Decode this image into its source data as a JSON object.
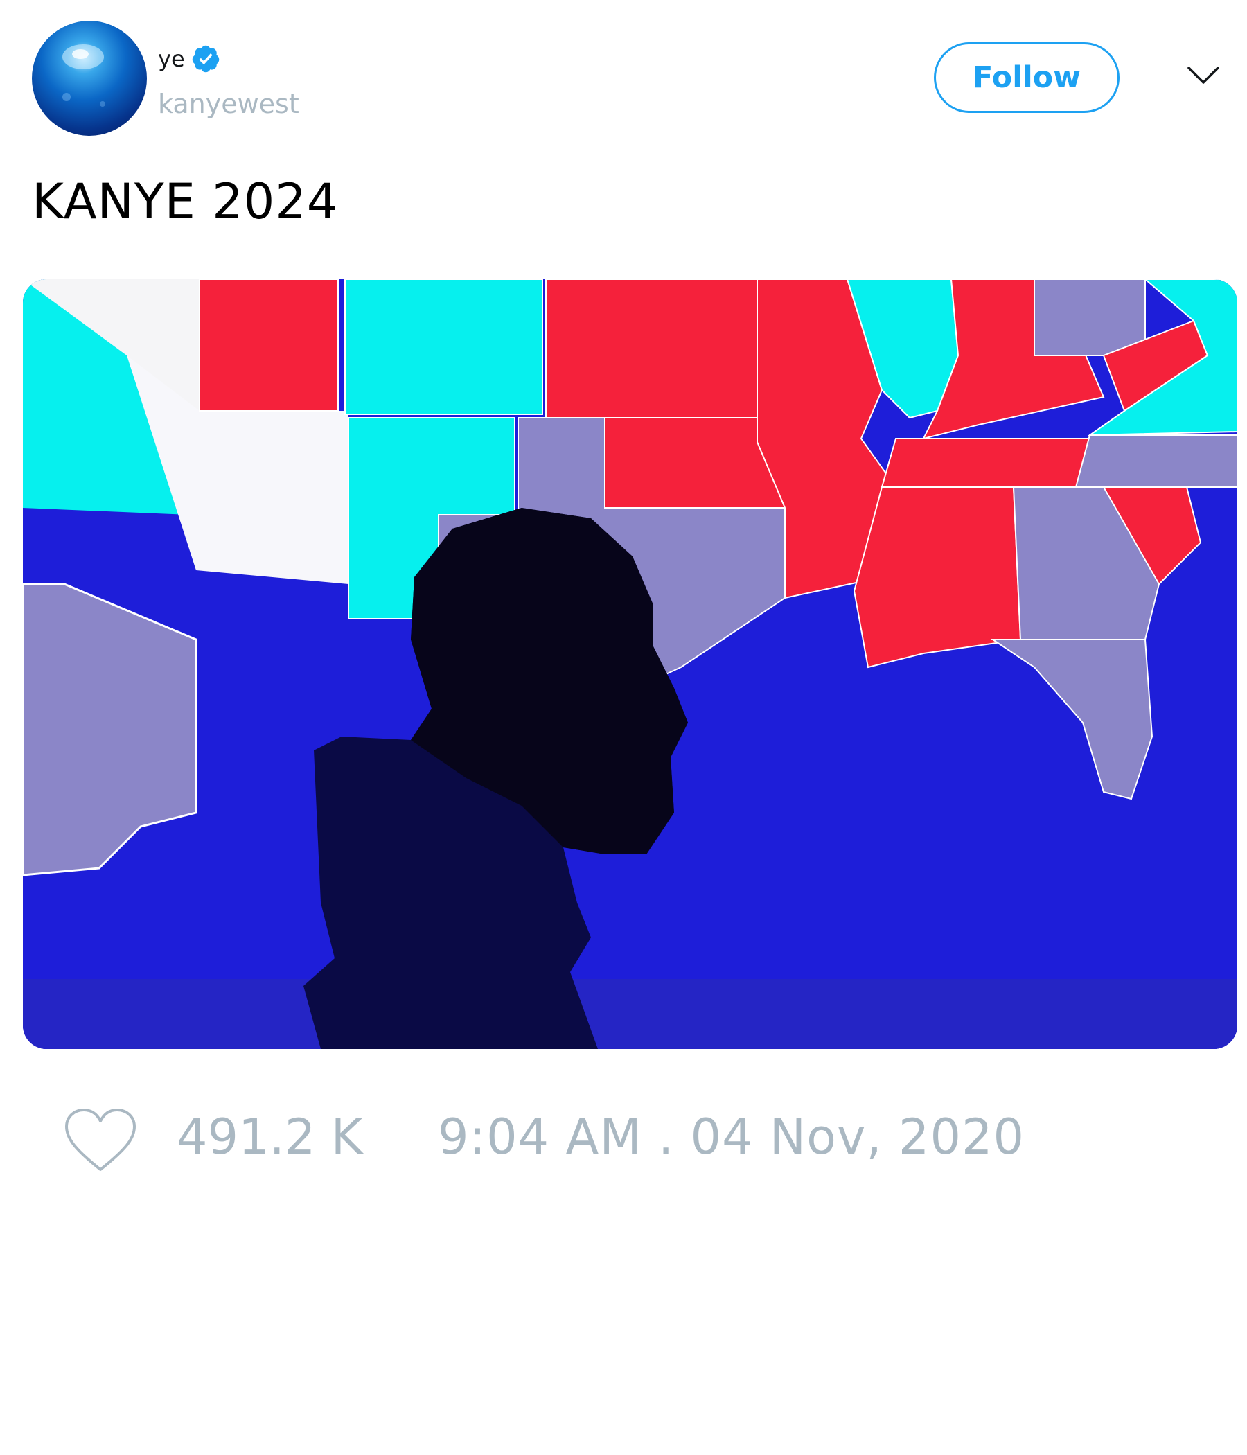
{
  "author": {
    "display_name": "ye",
    "handle": "kanyewest",
    "verified": true
  },
  "header": {
    "follow_label": "Follow"
  },
  "tweet": {
    "text": "KANYE 2024"
  },
  "media": {
    "description_icon": "photo",
    "accent_colors": {
      "red": "#f5213b",
      "cyan": "#06f0ee",
      "blue": "#1e1ed9",
      "gray": "#8b86c8"
    }
  },
  "footer": {
    "likes": "491.2 K",
    "timestamp": "9:04 AM . 04 Nov, 2020"
  },
  "colors": {
    "brand_blue": "#1da1f2",
    "muted_text": "#aab8c2",
    "text": "#14171a"
  }
}
